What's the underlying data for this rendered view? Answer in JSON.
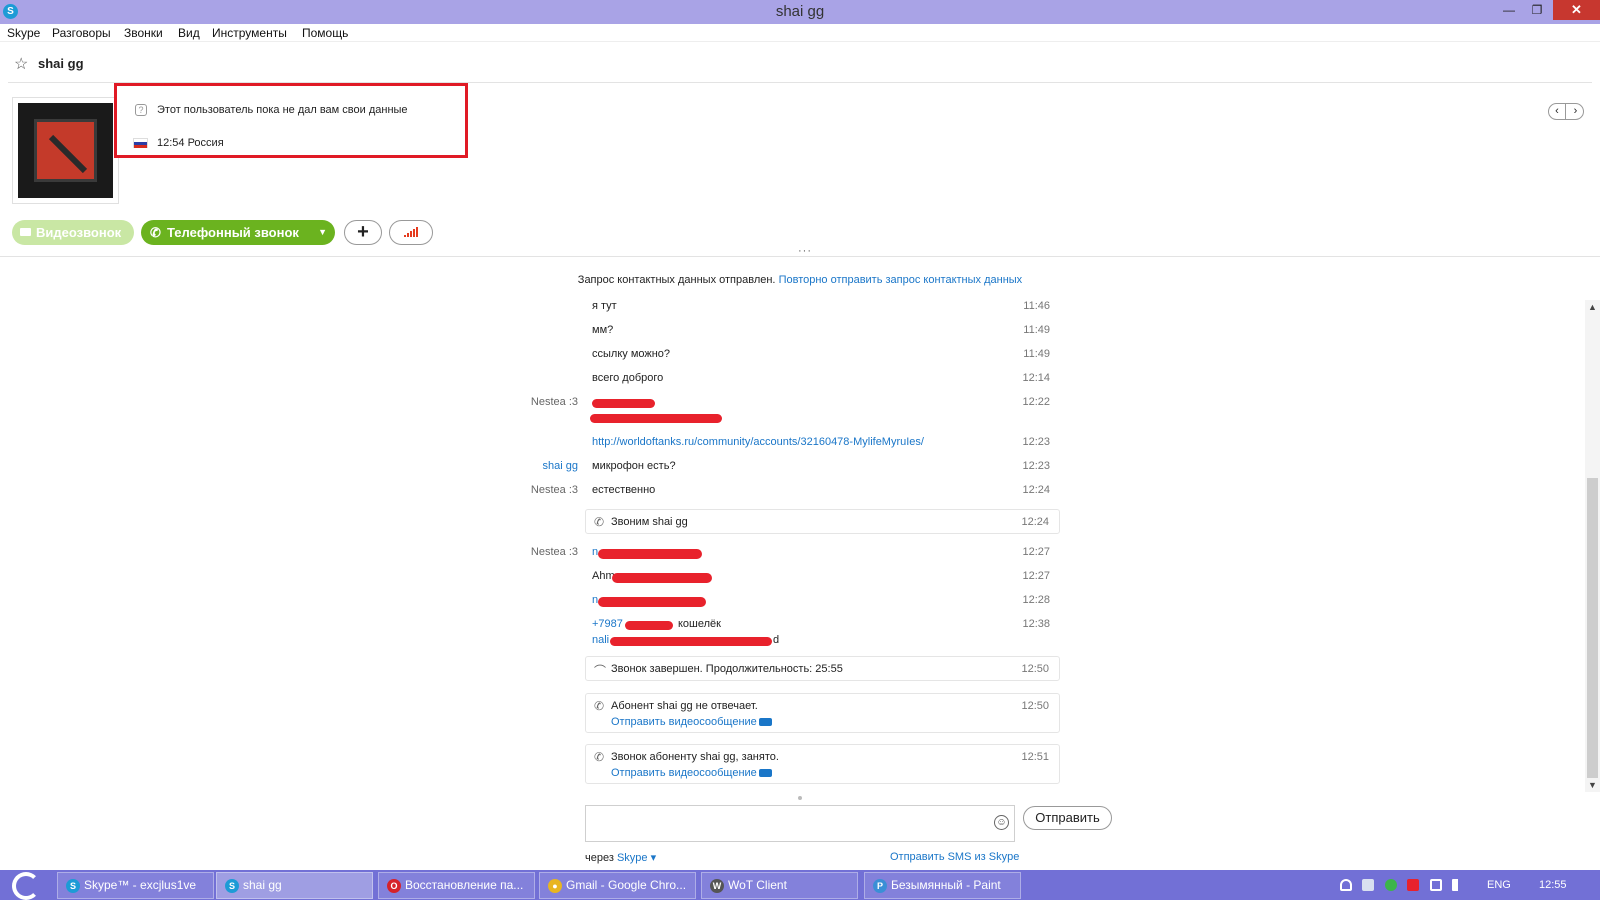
{
  "window": {
    "title": "shai gg"
  },
  "menu": [
    "Skype",
    "Разговоры",
    "Звонки",
    "Вид",
    "Инструменты",
    "Помощь"
  ],
  "contact": {
    "name": "shai gg",
    "info_text": "Этот пользователь пока не дал вам свои данные",
    "local_time": "12:54 Россия"
  },
  "buttons": {
    "video_call": "Видеозвонок",
    "phone_call": "Телефонный звонок",
    "send": "Отправить"
  },
  "request_note": {
    "text": "Запрос контактных данных отправлен.",
    "link": "Повторно отправить запрос контактных данных"
  },
  "messages": [
    {
      "sender": "",
      "text": "я тут",
      "time": "11:46"
    },
    {
      "sender": "",
      "text": "мм?",
      "time": "11:49"
    },
    {
      "sender": "",
      "text": "ссылку можно?",
      "time": "11:49"
    },
    {
      "sender": "",
      "text": "всего доброго",
      "time": "12:14"
    },
    {
      "sender": "Nestea :3",
      "text": "",
      "time": "12:22"
    },
    {
      "sender": "",
      "text": "http://worldoftanks.ru/community/accounts/32160478-MylifeMyruIes/",
      "time": "12:23"
    },
    {
      "sender": "shai gg",
      "text": "микрофон есть?",
      "time": "12:23"
    },
    {
      "sender": "Nestea :3",
      "text": "естественно",
      "time": "12:24"
    },
    {
      "sender": "Nestea :3",
      "text": "n",
      "time": "12:27"
    },
    {
      "sender": "",
      "text": "Ahm",
      "time": "12:27"
    },
    {
      "sender": "",
      "text": "n",
      "time": "12:28"
    },
    {
      "sender": "",
      "text": "+7987",
      "time": "12:38",
      "suffix": "кошелёк",
      "line2": "nali",
      "line2_end": "d"
    }
  ],
  "call_events": [
    {
      "text": "Звоним shai gg",
      "time": "12:24",
      "link": ""
    },
    {
      "text": "Звонок завершен. Продолжительность: 25:55",
      "time": "12:50",
      "link": ""
    },
    {
      "text": "Абонент shai gg не отвечает.",
      "time": "12:50",
      "link": "Отправить видеосообщение"
    },
    {
      "text": "Звонок абоненту shai gg, занято.",
      "time": "12:51",
      "link": "Отправить видеосообщение"
    }
  ],
  "compose": {
    "via_label": "через",
    "via_service": "Skype",
    "sms_link": "Отправить SMS из Skype"
  },
  "taskbar": {
    "items": [
      {
        "label": "Skype™ - excjlus1ve",
        "color": "#1d9bd6"
      },
      {
        "label": "shai gg",
        "color": "#1d9bd6"
      },
      {
        "label": "Восстановление па...",
        "color": "#d6222a"
      },
      {
        "label": "Gmail - Google Chro...",
        "color": "#e8b520"
      },
      {
        "label": "WoT Client",
        "color": "#555555"
      },
      {
        "label": "Безымянный - Paint",
        "color": "#3a8fd6"
      }
    ],
    "lang": "ENG",
    "clock": "12:55"
  }
}
